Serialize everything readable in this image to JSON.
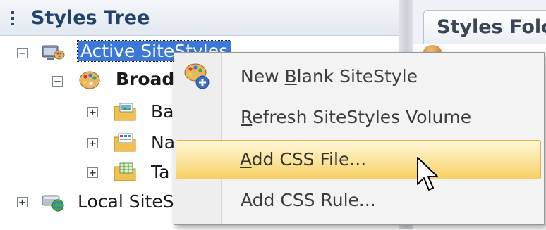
{
  "left_panel": {
    "title": "Styles Tree"
  },
  "right_panel": {
    "tab_label": "Styles Folc"
  },
  "tree": {
    "items": [
      {
        "label": "Active SiteStyles",
        "expander": "−",
        "selected": true
      },
      {
        "label": "Broad",
        "expander": "−",
        "bold": true
      },
      {
        "label": "Ba",
        "expander": "+"
      },
      {
        "label": "Na",
        "expander": "+"
      },
      {
        "label": "Ta",
        "expander": "+"
      },
      {
        "label": "Local SiteS",
        "expander": "+"
      }
    ]
  },
  "context_menu": {
    "items": [
      {
        "pre": "New ",
        "accel": "B",
        "post": "lank SiteStyle",
        "icon": "new-sitestyle-icon"
      },
      {
        "pre": "",
        "accel": "R",
        "post": "efresh SiteStyles Volume"
      },
      {
        "pre": "",
        "accel": "A",
        "post": "dd CSS File...",
        "highlighted": true
      },
      {
        "pre": "Add CSS Rule...",
        "accel": "",
        "post": ""
      }
    ]
  },
  "colors": {
    "selection": "#3b78d8",
    "menu_highlight": "#fbe49a",
    "title": "#20436e"
  }
}
